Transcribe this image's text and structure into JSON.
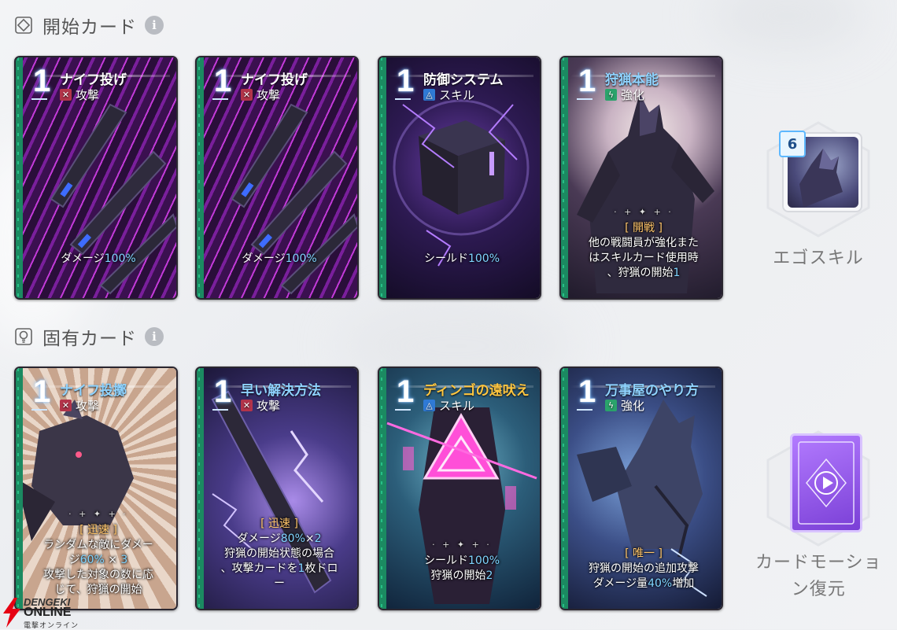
{
  "sections": {
    "starting": {
      "title": "開始カード"
    },
    "unique": {
      "title": "固有カード"
    }
  },
  "starting_cards": [
    {
      "cost": "1",
      "name": "ナイフ投げ",
      "type": "攻撃",
      "type_kind": "attack",
      "lines": [
        "ダメージ100%"
      ]
    },
    {
      "cost": "1",
      "name": "ナイフ投げ",
      "type": "攻撃",
      "type_kind": "attack",
      "lines": [
        "ダメージ100%"
      ]
    },
    {
      "cost": "1",
      "name": "防御システム",
      "type": "スキル",
      "type_kind": "skill",
      "lines": [
        "シールド100%"
      ]
    },
    {
      "cost": "1",
      "name": "狩猟本能",
      "type": "強化",
      "type_kind": "buff",
      "tag": "[ 開戦 ]",
      "lines": [
        "他の戦闘員が強化また",
        "はスキルカード使用時",
        "、狩猟の開始1"
      ]
    }
  ],
  "unique_cards": [
    {
      "cost": "1",
      "name": "ナイフ投擲",
      "type": "攻撃",
      "type_kind": "attack",
      "tag": "[ 迅速 ]",
      "lines": [
        "ランダムな敵にダメー",
        "ジ60% × 3",
        "攻撃した対象の数に応",
        "じて、狩猟の開始"
      ]
    },
    {
      "cost": "1",
      "name": "早い解決方法",
      "type": "攻撃",
      "type_kind": "attack",
      "tag": "[ 迅速 ]",
      "lines": [
        "ダメージ80%×2",
        "狩猟の開始状態の場合",
        "、攻撃カードを1枚ドロ",
        "ー"
      ]
    },
    {
      "cost": "1",
      "name": "ディンゴの遠吠え",
      "type": "スキル",
      "type_kind": "skill",
      "lines": [
        "シールド100%",
        "狩猟の開始2"
      ]
    },
    {
      "cost": "1",
      "name": "万事屋のやり方",
      "type": "強化",
      "type_kind": "buff",
      "tag": "[ 唯一 ]",
      "lines": [
        "狩猟の開始の追加攻撃",
        "ダメージ量40%増加"
      ]
    }
  ],
  "ego_skill": {
    "label": "エゴスキル",
    "cost": "6"
  },
  "card_motion": {
    "label_line1": "カードモーショ",
    "label_line2": "ン復元"
  },
  "watermark": {
    "line1": "DENGEKI",
    "line2": "ONLINE",
    "line3": "電撃オンライン"
  }
}
